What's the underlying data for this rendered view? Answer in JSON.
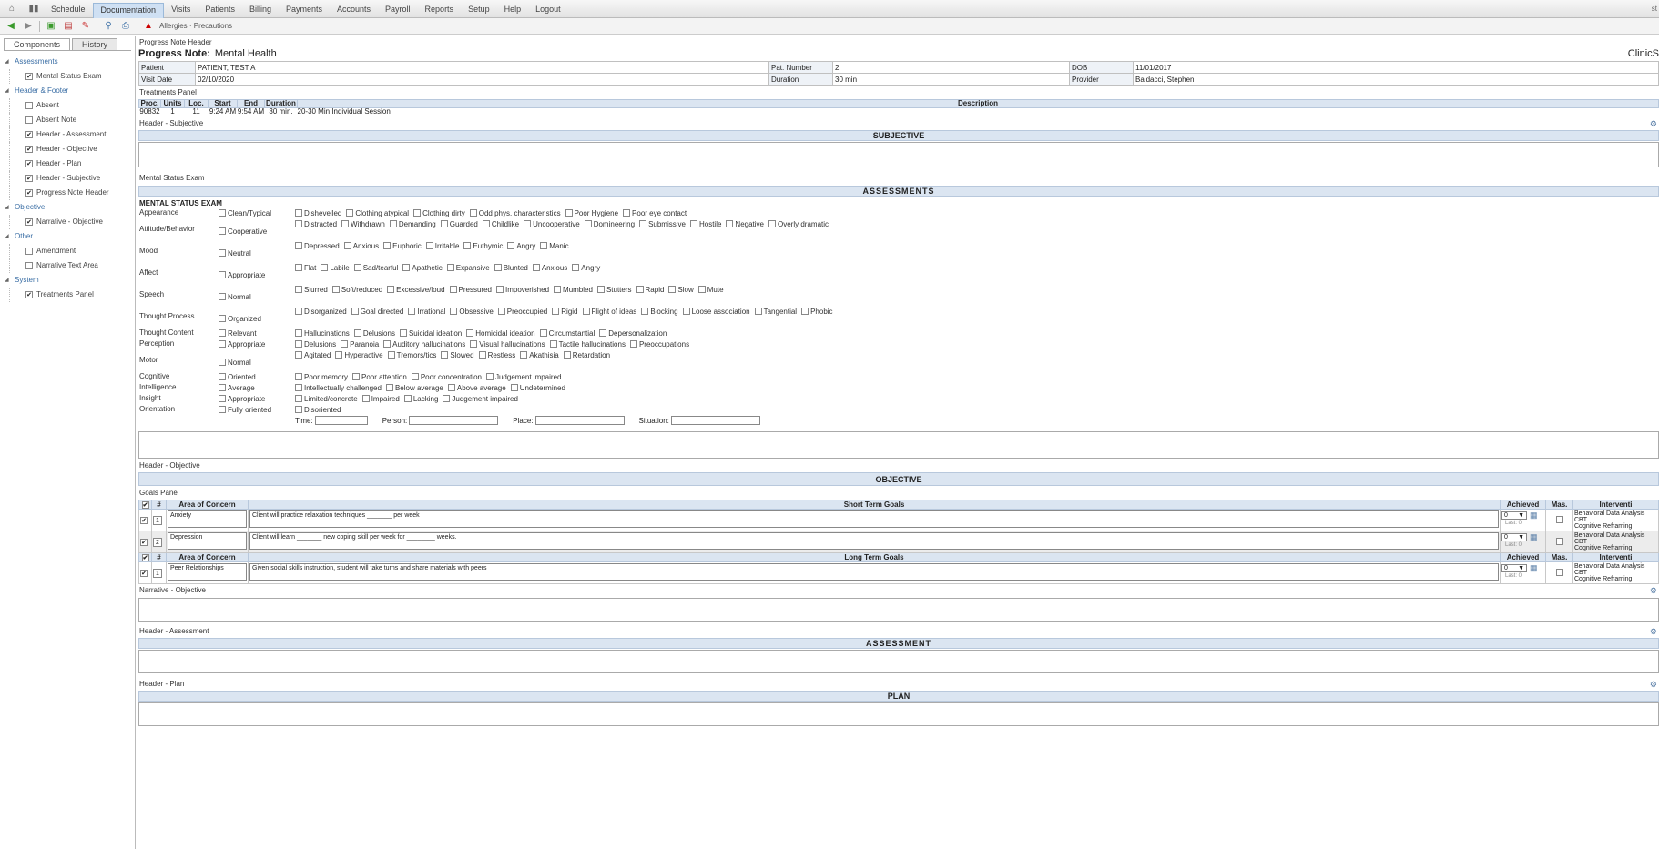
{
  "menu": {
    "items": [
      "Schedule",
      "Documentation",
      "Visits",
      "Patients",
      "Billing",
      "Payments",
      "Accounts",
      "Payroll",
      "Reports",
      "Setup",
      "Help",
      "Logout"
    ],
    "corner": "st"
  },
  "toolbar": {
    "alert_label": "Allergies · Precautions"
  },
  "sidebar": {
    "tabs": [
      "Components",
      "History"
    ],
    "groups": [
      {
        "name": "Assessments",
        "items": [
          {
            "label": "Mental Status Exam",
            "checked": true
          }
        ]
      },
      {
        "name": "Header & Footer",
        "items": [
          {
            "label": "Absent",
            "checked": false
          },
          {
            "label": "Absent Note",
            "checked": false
          },
          {
            "label": "Header - Assessment",
            "checked": true
          },
          {
            "label": "Header - Objective",
            "checked": true
          },
          {
            "label": "Header - Plan",
            "checked": true
          },
          {
            "label": "Header - Subjective",
            "checked": true
          },
          {
            "label": "Progress Note Header",
            "checked": true
          }
        ]
      },
      {
        "name": "Objective",
        "items": [
          {
            "label": "Narrative - Objective",
            "checked": true
          }
        ]
      },
      {
        "name": "Other",
        "items": [
          {
            "label": "Amendment",
            "checked": false
          },
          {
            "label": "Narrative Text Area",
            "checked": false
          }
        ]
      },
      {
        "name": "System",
        "items": [
          {
            "label": "Treatments Panel",
            "checked": true
          }
        ]
      }
    ]
  },
  "header": {
    "section_label": "Progress Note Header",
    "title_label": "Progress Note:",
    "title_value": "Mental Health",
    "right_text": "ClinicS",
    "patient_label": "Patient",
    "patient": "PATIENT, TEST A",
    "patnum_label": "Pat. Number",
    "patnum": "2",
    "dob_label": "DOB",
    "dob": "11/01/2017",
    "visit_label": "Visit Date",
    "visit": "02/10/2020",
    "duration_label": "Duration",
    "duration": "30 min",
    "provider_label": "Provider",
    "provider": "Baldacci, Stephen"
  },
  "treatments": {
    "label": "Treatments Panel",
    "headers": [
      "Proc.",
      "Units",
      "Loc.",
      "Start",
      "End",
      "Duration",
      "Description"
    ],
    "row": [
      "90832",
      "1",
      "11",
      "9:24 AM",
      "9:54 AM",
      "30 min.",
      "20-30 Min Individual Session"
    ]
  },
  "subjective": {
    "label": "Header - Subjective",
    "title": "SUBJECTIVE"
  },
  "mse": {
    "label": "Mental Status Exam",
    "title": "ASSESSMENTS",
    "heading": "MENTAL STATUS EXAM",
    "rows": [
      {
        "cat": "Appearance",
        "norm": "Clean/Typical",
        "opts": [
          "Dishevelled",
          "Clothing atypical",
          "Clothing dirty",
          "Odd phys. characteristics",
          "Poor Hygiene",
          "Poor eye contact"
        ]
      },
      {
        "cat": "Attitude/Behavior",
        "norm": "Cooperative",
        "opts": [
          "Distracted",
          "Withdrawn",
          "Demanding",
          "Guarded",
          "Childlike",
          "Uncooperative",
          "Domineering",
          "Submissive",
          "Hostile",
          "Negative",
          "Overly dramatic"
        ]
      },
      {
        "cat": "Mood",
        "norm": "Neutral",
        "opts": [
          "Depressed",
          "Anxious",
          "Euphoric",
          "Irritable",
          "Euthymic",
          "Angry",
          "Manic"
        ]
      },
      {
        "cat": "Affect",
        "norm": "Appropriate",
        "opts": [
          "Flat",
          "Labile",
          "Sad/tearful",
          "Apathetic",
          "Expansive",
          "Blunted",
          "Anxious",
          "Angry"
        ]
      },
      {
        "cat": "Speech",
        "norm": "Normal",
        "opts": [
          "Slurred",
          "Soft/reduced",
          "Excessive/loud",
          "Pressured",
          "Impoverished",
          "Mumbled",
          "Stutters",
          "Rapid",
          "Slow",
          "Mute"
        ]
      },
      {
        "cat": "Thought Process",
        "norm": "Organized",
        "opts": [
          "Disorganized",
          "Goal directed",
          "Irrational",
          "Obsessive",
          "Preoccupied",
          "Rigid",
          "Flight of ideas",
          "Blocking",
          "Loose association",
          "Tangential",
          "Phobic"
        ]
      },
      {
        "cat": "Thought Content",
        "norm": "Relevant",
        "opts": [
          "Hallucinations",
          "Delusions",
          "Suicidal ideation",
          "Homicidal ideation",
          "Circumstantial",
          "Depersonalization"
        ]
      },
      {
        "cat": "Perception",
        "norm": "Appropriate",
        "opts": [
          "Delusions",
          "Paranoia",
          "Auditory hallucinations",
          "Visual hallucinations",
          "Tactile hallucinations",
          "Preoccupations"
        ]
      },
      {
        "cat": "Motor",
        "norm": "Normal",
        "opts": [
          "Agitated",
          "Hyperactive",
          "Tremors/tics",
          "Slowed",
          "Restless",
          "Akathisia",
          "Retardation"
        ]
      },
      {
        "cat": "Cognitive",
        "norm": "Oriented",
        "opts": [
          "Poor memory",
          "Poor attention",
          "Poor concentration",
          "Judgement impaired"
        ]
      },
      {
        "cat": "Intelligence",
        "norm": "Average",
        "opts": [
          "Intellectually challenged",
          "Below average",
          "Above average",
          "Undetermined"
        ]
      },
      {
        "cat": "Insight",
        "norm": "Appropriate",
        "opts": [
          "Limited/concrete",
          "Impaired",
          "Lacking",
          "Judgement impaired"
        ]
      },
      {
        "cat": "Orientation",
        "norm": "Fully oriented",
        "opts": [
          "Disoriented"
        ]
      }
    ],
    "orient_fields": [
      "Time:",
      "Person:",
      "Place:",
      "Situation:"
    ]
  },
  "objective": {
    "label": "Header - Objective",
    "title": "OBJECTIVE",
    "goals_label": "Goals Panel",
    "col_num": "#",
    "col_area": "Area of Concern",
    "col_short": "Short Term Goals",
    "col_long": "Long Term Goals",
    "col_ach": "Achieved",
    "col_mas": "Mas.",
    "col_int": "Interventi",
    "short": [
      {
        "n": "1",
        "area": "Anxiety",
        "goal": "Client will practice relaxation techniques _______ per week",
        "sel": "0",
        "last": "Last: 0",
        "int": [
          "Behavioral Data Analysis",
          "CBT",
          "Cognitive Reframing"
        ]
      },
      {
        "n": "2",
        "area": "Depression",
        "goal": "Client will learn _______ new coping skill per week for ________ weeks.",
        "sel": "0",
        "last": "Last: 0",
        "int": [
          "Behavioral Data Analysis",
          "CBT",
          "Cognitive Reframing"
        ]
      }
    ],
    "long": [
      {
        "n": "1",
        "area": "Peer Relationships",
        "goal": "Given social skills instruction, student will take turns and share materials with peers",
        "sel": "0",
        "last": "Last: 0",
        "int": [
          "Behavioral Data Analysis",
          "CBT",
          "Cognitive Reframing"
        ]
      }
    ]
  },
  "narrative": {
    "label": "Narrative - Objective"
  },
  "assessment": {
    "label": "Header - Assessment",
    "title": "ASSESSMENT"
  },
  "plan": {
    "label": "Header - Plan",
    "title": "PLAN"
  }
}
